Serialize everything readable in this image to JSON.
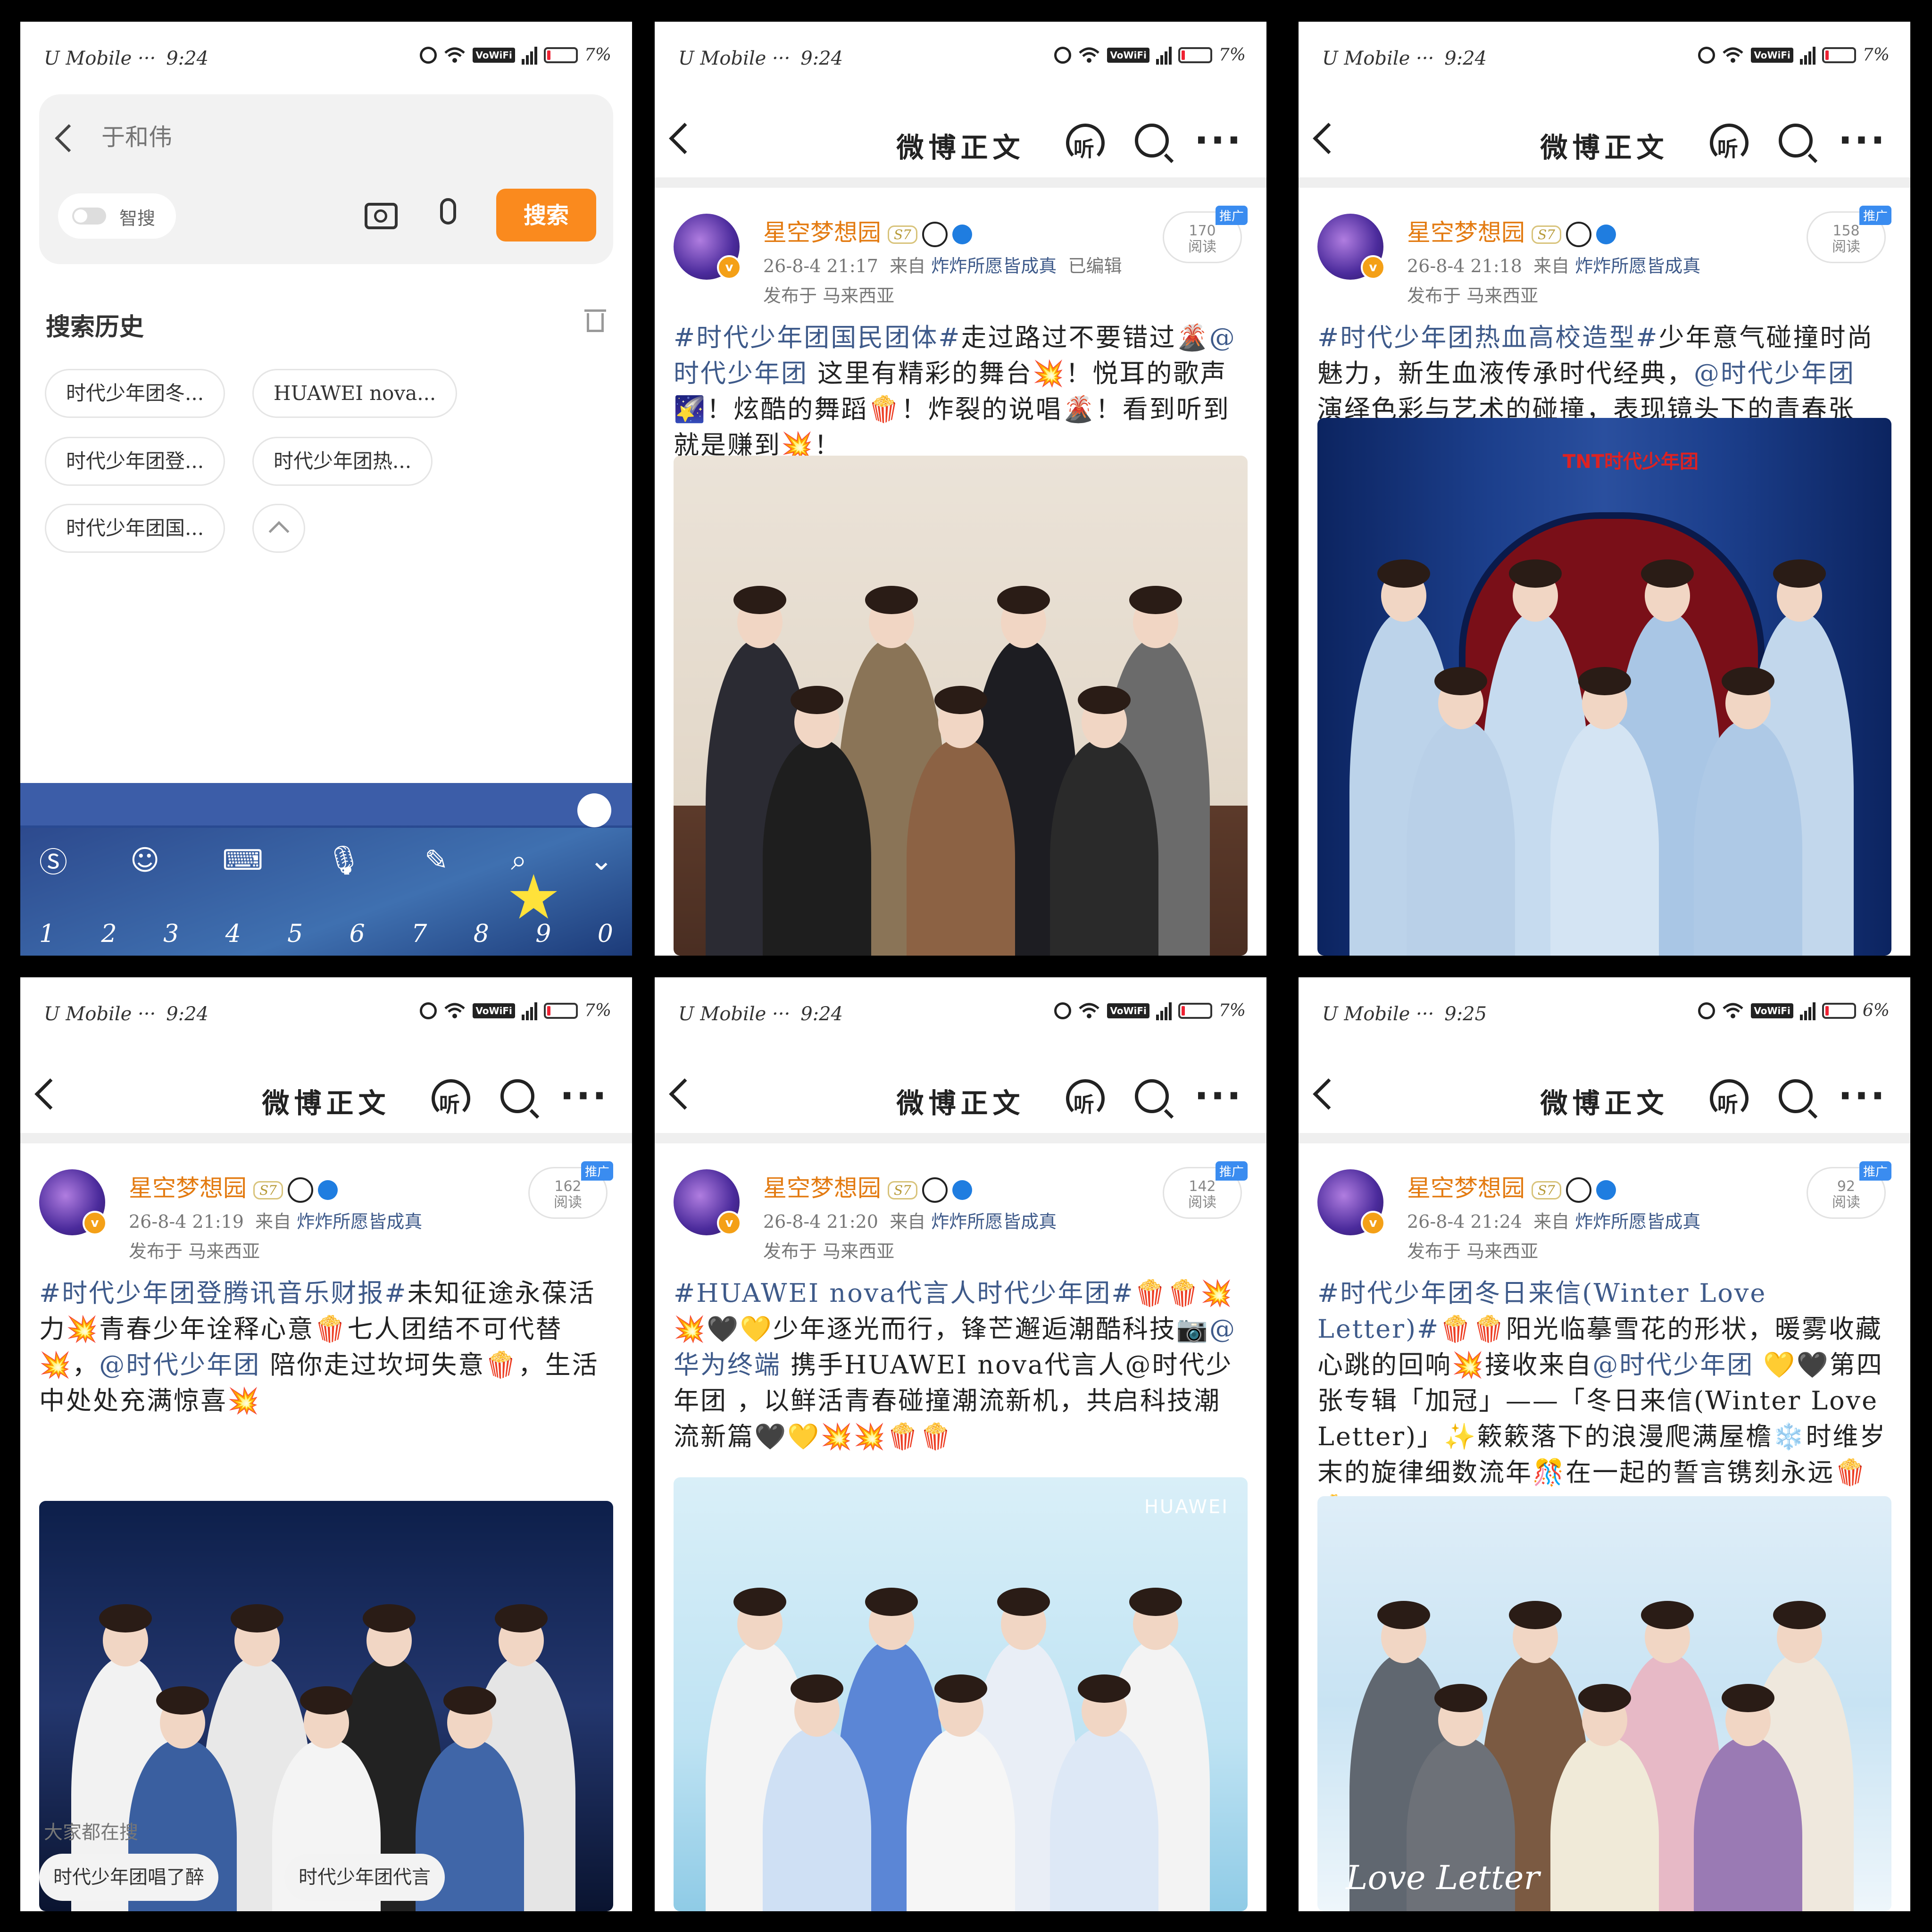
{
  "status": [
    {
      "carrier": "U Mobile ···",
      "time": "9:24",
      "battery": "7%"
    },
    {
      "carrier": "U Mobile ···",
      "time": "9:24",
      "battery": "7%"
    },
    {
      "carrier": "U Mobile ···",
      "time": "9:24",
      "battery": "7%"
    },
    {
      "carrier": "U Mobile ···",
      "time": "9:24",
      "battery": "7%"
    },
    {
      "carrier": "U Mobile ···",
      "time": "9:24",
      "battery": "7%"
    },
    {
      "carrier": "U Mobile ···",
      "time": "9:25",
      "battery": "6%"
    }
  ],
  "status_icons": {
    "vowifi": "VoWiFi",
    "net": "4G"
  },
  "search": {
    "placeholder": "于和伟",
    "toggle_label": "智搜",
    "button": "搜索",
    "history_title": "搜索历史",
    "history": [
      "时代少年团冬...",
      "HUAWEI nova...",
      "时代少年团登...",
      "时代少年团热...",
      "时代少年团国..."
    ],
    "keyboard_nums": [
      "1",
      "2",
      "3",
      "4",
      "5",
      "6",
      "7",
      "8",
      "9",
      "0"
    ]
  },
  "header": {
    "title": "微博正文",
    "listen": "听"
  },
  "post_common": {
    "user": "星空梦想园",
    "level": "S7",
    "from": "来自",
    "source": "炸炸所愿皆成真",
    "location": "发布于 马来西亚",
    "promo": "推广",
    "reads_label": "阅读"
  },
  "posts": [
    {
      "time": "26-8-4 21:17",
      "edited": "已编辑",
      "reads": "170",
      "tag": "#时代少年团国民团体#",
      "text": "走过路过不要错过🌋",
      "mention": "@时代少年团",
      "text2": " 这里有精彩的舞台💥！悦耳的歌声🌠！炫酷的舞蹈🍿！炸裂的说唱🌋！看到听到就是赚到💥！"
    },
    {
      "time": "26-8-4 21:18",
      "edited": "",
      "reads": "158",
      "tag": "#时代少年团热血高校造型#",
      "text": "少年意气碰撞时尚魅力，新生血液传承时代经典，",
      "mention": "@时代少年团",
      "text2": " 演绎色彩与艺术的碰撞，表现镜头下的青春张力，"
    },
    {
      "time": "26-8-4 21:19",
      "edited": "",
      "reads": "162",
      "tag": "#时代少年团登腾讯音乐财报#",
      "text": "未知征途永葆活力💥青春少年诠释心意🍿七人团结不可代替💥，",
      "mention": "@时代少年团",
      "text2": " 陪你走过坎坷失意🍿，生活中处处充满惊喜💥"
    },
    {
      "time": "26-8-4 21:20",
      "edited": "",
      "reads": "142",
      "tag": "#HUAWEI nova代言人时代少年团#",
      "text": "🍿🍿💥💥🖤💛少年逐光而行，锋芒邂逅潮酷科技📷",
      "mention": "@华为终端",
      "text2": " 携手HUAWEI nova代言人@时代少年团 ，以鲜活青春碰撞潮流新机，共启科技潮流新篇🖤💛💥💥🍿🍿"
    },
    {
      "time": "26-8-4 21:24",
      "edited": "",
      "reads": "92",
      "tag": "#时代少年团冬日来信(Winter Love Letter)#",
      "text": "🍿🍿阳光临摹雪花的形状，暖雾收藏心跳的回响💥接收来自",
      "mention": "@时代少年团",
      "text2": " 💛🖤第四张专辑「加冠」——「冬日来信(Winter Love Letter)」✨簌簌落下的浪漫爬满屋檐❄️时维岁末的旋律细数流年🎊在一起的誓言镌刻永远🍿🍿"
    }
  ],
  "photo_marks": {
    "p3_logo": "TNT时代少年团",
    "p5_logo": "HUAWEI",
    "p6_title": "Love Letter"
  },
  "trending": {
    "label": "大家都在搜",
    "items": [
      "时代少年团唱了醉",
      "时代少年团代言"
    ]
  },
  "colors": {
    "accent": "#fa8a1e",
    "link": "#3e5a8a",
    "username": "#e37b12",
    "promo": "#3a8cf0",
    "keyboard": "#26478f"
  }
}
